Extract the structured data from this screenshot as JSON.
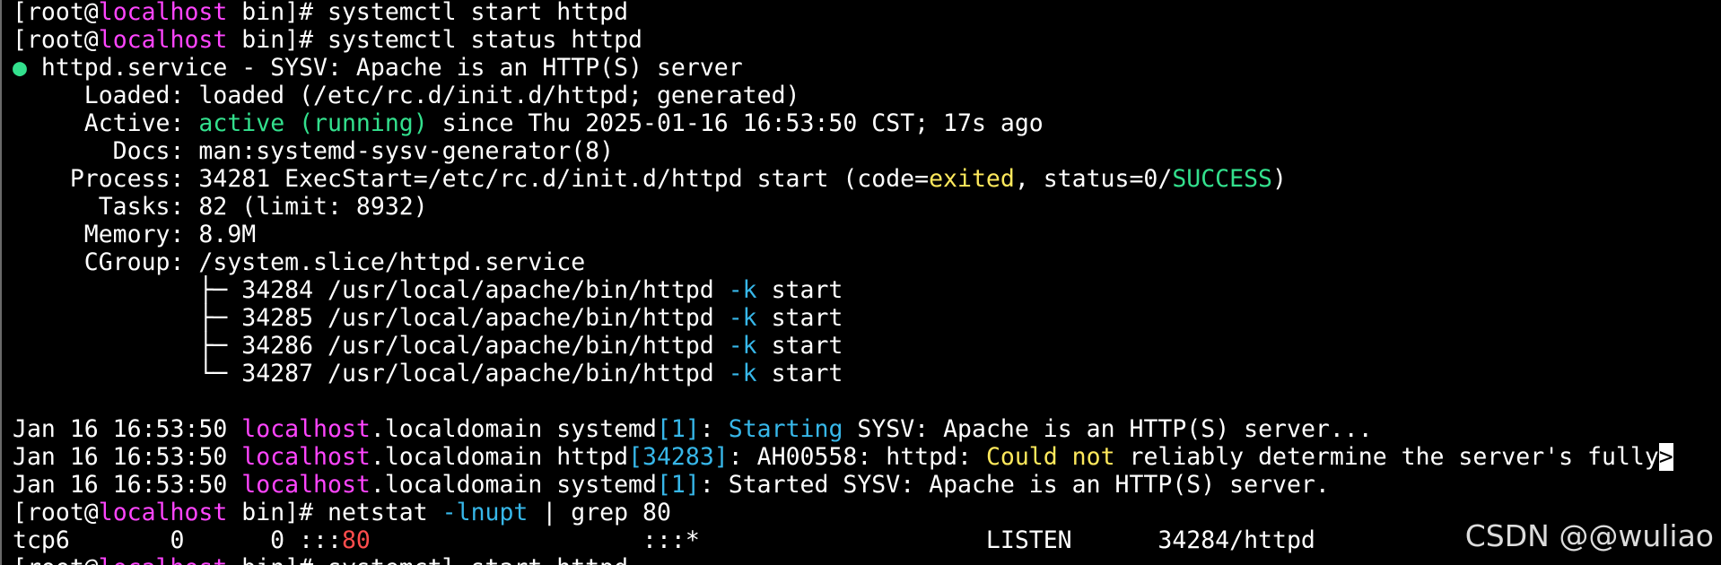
{
  "terminal": {
    "lines": [
      {
        "segments": [
          {
            "t": "[root@",
            "c": ""
          },
          {
            "t": "localhost",
            "c": "magenta"
          },
          {
            "t": " bin]# systemctl start httpd",
            "c": ""
          }
        ]
      },
      {
        "segments": [
          {
            "t": "[root@",
            "c": ""
          },
          {
            "t": "localhost",
            "c": "magenta"
          },
          {
            "t": " bin]# systemctl status httpd",
            "c": ""
          }
        ]
      },
      {
        "segments": [
          {
            "t": "●",
            "c": "green"
          },
          {
            "t": " httpd.service - SYSV: Apache is an HTTP(S) server",
            "c": ""
          }
        ]
      },
      {
        "segments": [
          {
            "t": "     Loaded: loaded (/etc/rc.d/init.d/httpd; generated)",
            "c": ""
          }
        ]
      },
      {
        "segments": [
          {
            "t": "     Active: ",
            "c": ""
          },
          {
            "t": "active (running)",
            "c": "green"
          },
          {
            "t": " since Thu 2025-01-16 16:53:50 CST; 17s ago",
            "c": ""
          }
        ]
      },
      {
        "segments": [
          {
            "t": "       Docs: man:systemd-sysv-generator(8)",
            "c": ""
          }
        ]
      },
      {
        "segments": [
          {
            "t": "    Process: 34281 ExecStart=/etc/rc.d/init.d/httpd start (code=",
            "c": ""
          },
          {
            "t": "exited",
            "c": "yellow"
          },
          {
            "t": ", status=0/",
            "c": ""
          },
          {
            "t": "SUCCESS",
            "c": "green"
          },
          {
            "t": ")",
            "c": ""
          }
        ]
      },
      {
        "segments": [
          {
            "t": "      Tasks: 82 (limit: 8932)",
            "c": ""
          }
        ]
      },
      {
        "segments": [
          {
            "t": "     Memory: 8.9M",
            "c": ""
          }
        ]
      },
      {
        "segments": [
          {
            "t": "     CGroup: /system.slice/httpd.service",
            "c": ""
          }
        ]
      },
      {
        "segments": [
          {
            "t": "             ├─ 34284 /usr/local/apache/bin/httpd ",
            "c": ""
          },
          {
            "t": "-k",
            "c": "cyan"
          },
          {
            "t": " start",
            "c": ""
          }
        ]
      },
      {
        "segments": [
          {
            "t": "             ├─ 34285 /usr/local/apache/bin/httpd ",
            "c": ""
          },
          {
            "t": "-k",
            "c": "cyan"
          },
          {
            "t": " start",
            "c": ""
          }
        ]
      },
      {
        "segments": [
          {
            "t": "             ├─ 34286 /usr/local/apache/bin/httpd ",
            "c": ""
          },
          {
            "t": "-k",
            "c": "cyan"
          },
          {
            "t": " start",
            "c": ""
          }
        ]
      },
      {
        "segments": [
          {
            "t": "             └─ 34287 /usr/local/apache/bin/httpd ",
            "c": ""
          },
          {
            "t": "-k",
            "c": "cyan"
          },
          {
            "t": " start",
            "c": ""
          }
        ]
      },
      {
        "segments": [
          {
            "t": "",
            "c": ""
          }
        ]
      },
      {
        "segments": [
          {
            "t": "Jan 16 16:53:50 ",
            "c": ""
          },
          {
            "t": "localhost",
            "c": "magenta"
          },
          {
            "t": ".localdomain systemd",
            "c": ""
          },
          {
            "t": "[1]",
            "c": "cyan"
          },
          {
            "t": ": ",
            "c": ""
          },
          {
            "t": "Starting",
            "c": "cyan"
          },
          {
            "t": " SYSV: Apache is an HTTP(S) server...",
            "c": ""
          }
        ]
      },
      {
        "segments": [
          {
            "t": "Jan 16 16:53:50 ",
            "c": ""
          },
          {
            "t": "localhost",
            "c": "magenta"
          },
          {
            "t": ".localdomain httpd",
            "c": ""
          },
          {
            "t": "[34283]",
            "c": "cyan"
          },
          {
            "t": ": AH00558: httpd: ",
            "c": ""
          },
          {
            "t": "Could not",
            "c": "yellow"
          },
          {
            "t": " reliably determine the server's fully",
            "c": ""
          },
          {
            "t": ">",
            "c": "cursor"
          }
        ]
      },
      {
        "segments": [
          {
            "t": "Jan 16 16:53:50 ",
            "c": ""
          },
          {
            "t": "localhost",
            "c": "magenta"
          },
          {
            "t": ".localdomain systemd",
            "c": ""
          },
          {
            "t": "[1]",
            "c": "cyan"
          },
          {
            "t": ": Started SYSV: Apache is an HTTP(S) server.",
            "c": ""
          }
        ]
      },
      {
        "segments": [
          {
            "t": "[root@",
            "c": ""
          },
          {
            "t": "localhost",
            "c": "magenta"
          },
          {
            "t": " bin]# netstat ",
            "c": ""
          },
          {
            "t": "-lnupt",
            "c": "cyan"
          },
          {
            "t": " | grep 80",
            "c": ""
          }
        ]
      },
      {
        "segments": [
          {
            "t": "tcp6       0      0 :::",
            "c": ""
          },
          {
            "t": "80",
            "c": "red"
          },
          {
            "t": "                   :::*                    LISTEN      34284/httpd",
            "c": ""
          }
        ]
      },
      {
        "segments": [
          {
            "t": "[root@",
            "c": ""
          },
          {
            "t": "localhost",
            "c": "magenta"
          },
          {
            "t": " bin]# systemctl start httpd",
            "c": ""
          }
        ]
      }
    ]
  },
  "watermark": {
    "text": "CSDN @@wuliao"
  }
}
